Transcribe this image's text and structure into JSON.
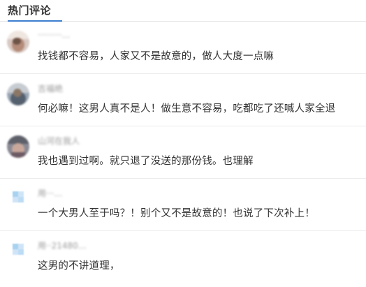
{
  "header": {
    "title": "热门评论"
  },
  "comments": [
    {
      "username": "·········…",
      "text": "找钱都不容易，人家又不是故意的，做人大度一点嘛",
      "avatar": "photo-avatar"
    },
    {
      "username": "吉福绝",
      "text": "何必嘛！这男人真不是人！做生意不容易，吃都吃了还喊人家全退",
      "avatar": "photo-avatar"
    },
    {
      "username": "山河在我人",
      "text": "我也遇到过啊。就只退了没送的那份钱。也理解",
      "avatar": "photo-avatar"
    },
    {
      "username": "用···…",
      "text": "一个大男人至于吗？！别个又不是故意的！也说了下次补上！",
      "avatar": "default-avatar"
    },
    {
      "username": "用··21480…",
      "text": "这男的不讲道理，",
      "avatar": "default-avatar"
    }
  ],
  "colors": {
    "accent": "#3d7fd1",
    "text": "#333333",
    "meta": "#9a9a9a",
    "divider": "#ececec"
  }
}
